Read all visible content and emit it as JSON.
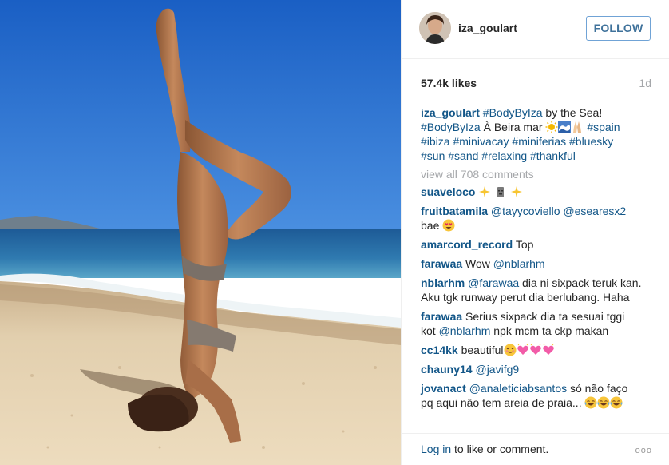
{
  "post": {
    "username": "iza_goulart",
    "follow_label": "FOLLOW",
    "likes": "57.4k likes",
    "age": "1d",
    "view_all": "view all 708 comments"
  },
  "caption": {
    "user": "iza_goulart",
    "line1_tag": "#BodyByIza",
    "line1_text": " by the Sea!",
    "line2_tag": "#BodyByIza",
    "line2_text": " À Beira mar ",
    "line2_tag2": "#spain",
    "tags_line3": [
      "#ibiza",
      "#minivacay",
      "#miniferias",
      "#bluesky"
    ],
    "tags_line4": [
      "#sun",
      "#sand",
      "#relaxing",
      "#thankful"
    ]
  },
  "comments": [
    {
      "user": "suaveloco",
      "text": ""
    },
    {
      "user": "fruitbatamila",
      "mentions": [
        "@tayycoviello",
        "@esearesx2"
      ],
      "text2": "bae"
    },
    {
      "user": "amarcord_record",
      "text": "Top"
    },
    {
      "user": "farawaa",
      "text": "Wow ",
      "mention": "@nblarhm"
    },
    {
      "user": "nblarhm",
      "mention": "@farawaa",
      "text": " dia ni sixpack teruk kan.",
      "text2": "Aku tgk runway perut dia berlubang. Haha"
    },
    {
      "user": "farawaa",
      "text": "Serius sixpack dia ta sesuai tggi",
      "text2a": "kot ",
      "mention": "@nblarhm",
      "text2b": " npk mcm ta ckp makan"
    },
    {
      "user": "cc14kk",
      "text": "beautiful"
    },
    {
      "user": "chauny14",
      "mention": "@javifg9"
    },
    {
      "user": "jovanact",
      "mention": "@analeticiabsantos",
      "text": " só não faço",
      "text2": "pq aqui não tem areia de praia... "
    }
  ],
  "footer": {
    "login_link": "Log in",
    "login_rest": " to like or comment.",
    "more": "ooo"
  },
  "colors": {
    "link": "#125688",
    "follow_border": "#70a3d6",
    "muted": "#a5a7aa"
  }
}
